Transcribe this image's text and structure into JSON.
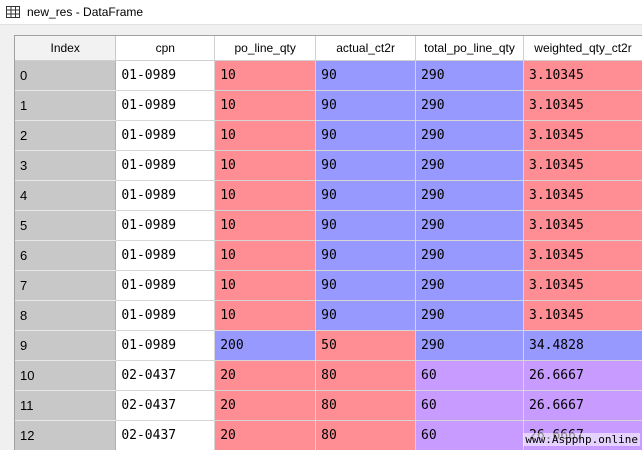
{
  "window": {
    "title": "new_res - DataFrame",
    "icon": "table-icon"
  },
  "table": {
    "columns": [
      "Index",
      "cpn",
      "po_line_qty",
      "actual_ct2r",
      "total_po_line_qty",
      "weighted_qty_ct2r"
    ],
    "rows": [
      {
        "index": "0",
        "cpn": "01-0989",
        "po_line_qty": "10",
        "actual_ct2r": "90",
        "total_po_line_qty": "290",
        "weighted_qty_ct2r": "3.10345"
      },
      {
        "index": "1",
        "cpn": "01-0989",
        "po_line_qty": "10",
        "actual_ct2r": "90",
        "total_po_line_qty": "290",
        "weighted_qty_ct2r": "3.10345"
      },
      {
        "index": "2",
        "cpn": "01-0989",
        "po_line_qty": "10",
        "actual_ct2r": "90",
        "total_po_line_qty": "290",
        "weighted_qty_ct2r": "3.10345"
      },
      {
        "index": "3",
        "cpn": "01-0989",
        "po_line_qty": "10",
        "actual_ct2r": "90",
        "total_po_line_qty": "290",
        "weighted_qty_ct2r": "3.10345"
      },
      {
        "index": "4",
        "cpn": "01-0989",
        "po_line_qty": "10",
        "actual_ct2r": "90",
        "total_po_line_qty": "290",
        "weighted_qty_ct2r": "3.10345"
      },
      {
        "index": "5",
        "cpn": "01-0989",
        "po_line_qty": "10",
        "actual_ct2r": "90",
        "total_po_line_qty": "290",
        "weighted_qty_ct2r": "3.10345"
      },
      {
        "index": "6",
        "cpn": "01-0989",
        "po_line_qty": "10",
        "actual_ct2r": "90",
        "total_po_line_qty": "290",
        "weighted_qty_ct2r": "3.10345"
      },
      {
        "index": "7",
        "cpn": "01-0989",
        "po_line_qty": "10",
        "actual_ct2r": "90",
        "total_po_line_qty": "290",
        "weighted_qty_ct2r": "3.10345"
      },
      {
        "index": "8",
        "cpn": "01-0989",
        "po_line_qty": "10",
        "actual_ct2r": "90",
        "total_po_line_qty": "290",
        "weighted_qty_ct2r": "3.10345"
      },
      {
        "index": "9",
        "cpn": "01-0989",
        "po_line_qty": "200",
        "actual_ct2r": "50",
        "total_po_line_qty": "290",
        "weighted_qty_ct2r": "34.4828"
      },
      {
        "index": "10",
        "cpn": "02-0437",
        "po_line_qty": "20",
        "actual_ct2r": "80",
        "total_po_line_qty": "60",
        "weighted_qty_ct2r": "26.6667"
      },
      {
        "index": "11",
        "cpn": "02-0437",
        "po_line_qty": "20",
        "actual_ct2r": "80",
        "total_po_line_qty": "60",
        "weighted_qty_ct2r": "26.6667"
      },
      {
        "index": "12",
        "cpn": "02-0437",
        "po_line_qty": "20",
        "actual_ct2r": "80",
        "total_po_line_qty": "60",
        "weighted_qty_ct2r": "26.6667"
      }
    ],
    "cell_colors": [
      [
        "red",
        "blue",
        "blue",
        "red"
      ],
      [
        "red",
        "blue",
        "blue",
        "red"
      ],
      [
        "red",
        "blue",
        "blue",
        "red"
      ],
      [
        "red",
        "blue",
        "blue",
        "red"
      ],
      [
        "red",
        "blue",
        "blue",
        "red"
      ],
      [
        "red",
        "blue",
        "blue",
        "red"
      ],
      [
        "red",
        "blue",
        "blue",
        "red"
      ],
      [
        "red",
        "blue",
        "blue",
        "red"
      ],
      [
        "red",
        "blue",
        "blue",
        "red"
      ],
      [
        "blue",
        "red",
        "blue",
        "blue"
      ],
      [
        "red",
        "red",
        "purple",
        "purple"
      ],
      [
        "red",
        "red",
        "purple",
        "purple"
      ],
      [
        "red",
        "red",
        "purple",
        "purple"
      ]
    ]
  },
  "colors": {
    "red": "#ff8e94",
    "blue": "#9899ff",
    "purple": "#c79bff",
    "index_bg": "#c8c8c8"
  },
  "watermark": "www.Aspphp.online"
}
